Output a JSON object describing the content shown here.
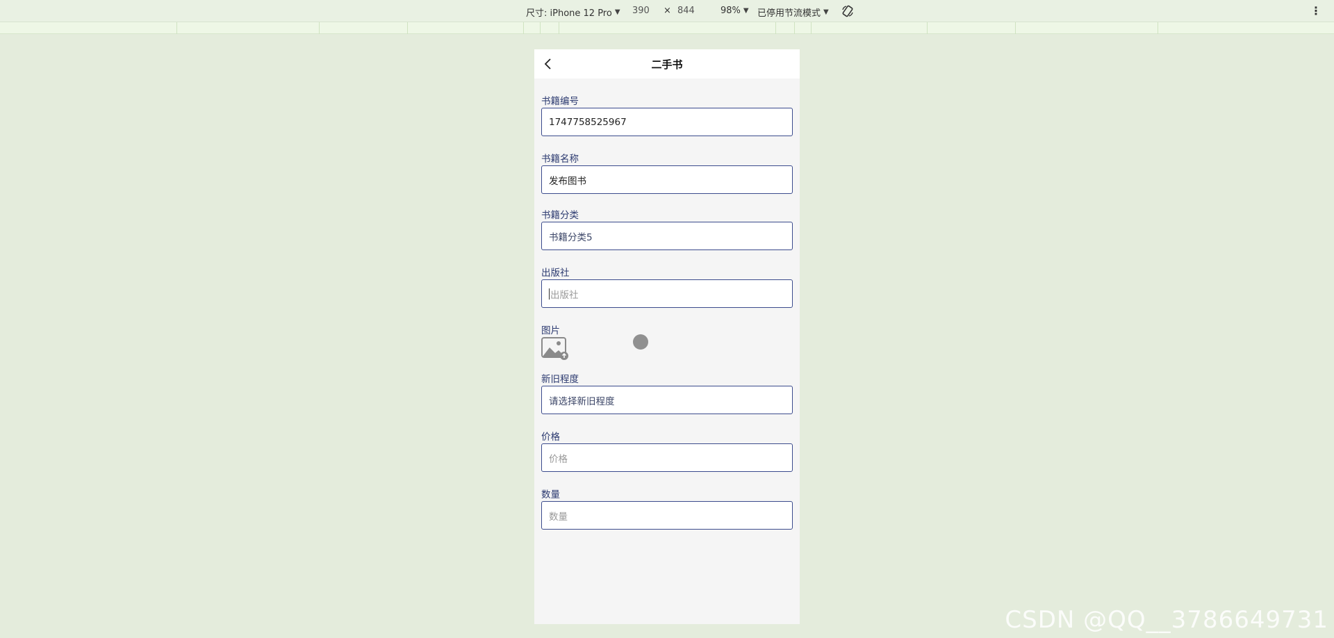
{
  "devtools": {
    "device_label": "尺寸: iPhone 12 Pro",
    "width": "390",
    "times": "×",
    "height": "844",
    "zoom": "98%",
    "throttle": "已停用节流模式"
  },
  "nav": {
    "title": "二手书",
    "back_icon": "chevron-left-icon"
  },
  "form": {
    "book_id": {
      "label": "书籍编号",
      "value": "1747758525967"
    },
    "book_name": {
      "label": "书籍名称",
      "value": "发布图书"
    },
    "category": {
      "label": "书籍分类",
      "value": "书籍分类5"
    },
    "publisher": {
      "label": "出版社",
      "placeholder": "出版社"
    },
    "image": {
      "label": "图片",
      "icon": "image-upload-icon"
    },
    "condition": {
      "label": "新旧程度",
      "placeholder": "请选择新旧程度"
    },
    "price": {
      "label": "价格",
      "placeholder": "价格"
    },
    "quantity": {
      "label": "数量",
      "placeholder": "数量"
    }
  },
  "watermark": "CSDN @QQ__3786649731",
  "colors": {
    "page_bg": "#e4ecdc",
    "phone_bg": "#f5f5f5",
    "input_border": "#3a4a8c",
    "label": "#2c3a70"
  }
}
